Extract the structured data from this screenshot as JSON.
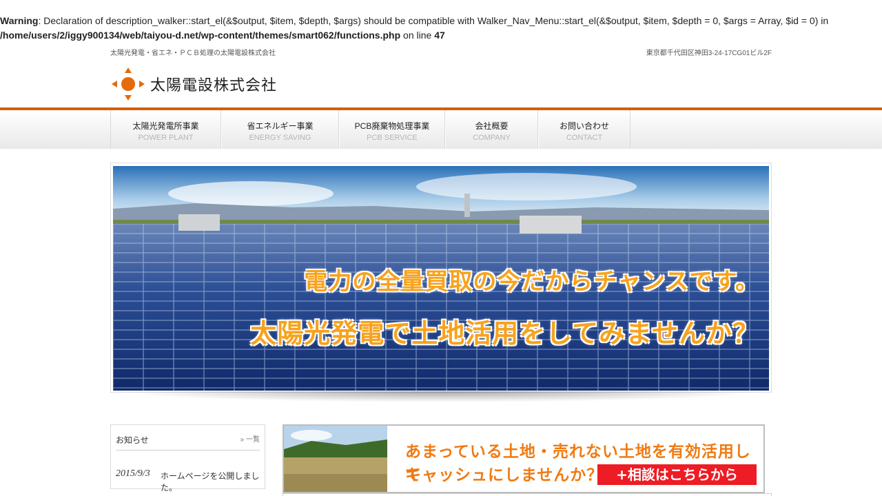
{
  "warning": {
    "label": "Warning",
    "message": ": Declaration of description_walker::start_el(&$output, $item, $depth, $args) should be compatible with Walker_Nav_Menu::start_el(&$output, $item, $depth = 0, $args = Array, $id = 0) in",
    "file": "/home/users/2/iggy900134/web/taiyou-d.net/wp-content/themes/smart062/functions.php",
    "on_line_text": " on line ",
    "line": "47"
  },
  "header": {
    "tagline": "太陽光発電・省エネ・ＰＣＢ処理の太陽電設株式会社",
    "address": "東京都千代田区神田3-24-17CG01ビル2F",
    "logo_text": "太陽電設株式会社"
  },
  "nav": {
    "items": [
      {
        "ja": "太陽光発電所事業",
        "en": "POWER PLANT"
      },
      {
        "ja": "省エネルギー事業",
        "en": "ENERGY SAVING"
      },
      {
        "ja": "PCB廃棄物処理事業",
        "en": "PCB SERVICE"
      },
      {
        "ja": "会社概要",
        "en": "COMPANY"
      },
      {
        "ja": "お問い合わせ",
        "en": "CONTACT"
      }
    ]
  },
  "hero": {
    "line1": "電力の全量買取の今だからチャンスです。",
    "line2": "太陽光発電で土地活用をしてみませんか？"
  },
  "news": {
    "title": "お知らせ",
    "more": "» 一覧",
    "items": [
      {
        "date": "2015/9/3",
        "text": "ホームページを公開しました。"
      }
    ]
  },
  "banner": {
    "line1": "あまっている土地・売れない土地を有効活用して",
    "line2": "キャッシュにしませんか？",
    "button": "+相談はこちらから"
  },
  "colors": {
    "accent": "#d35f0a",
    "banner_text": "#f07a12",
    "cta": "#ee1c24"
  }
}
